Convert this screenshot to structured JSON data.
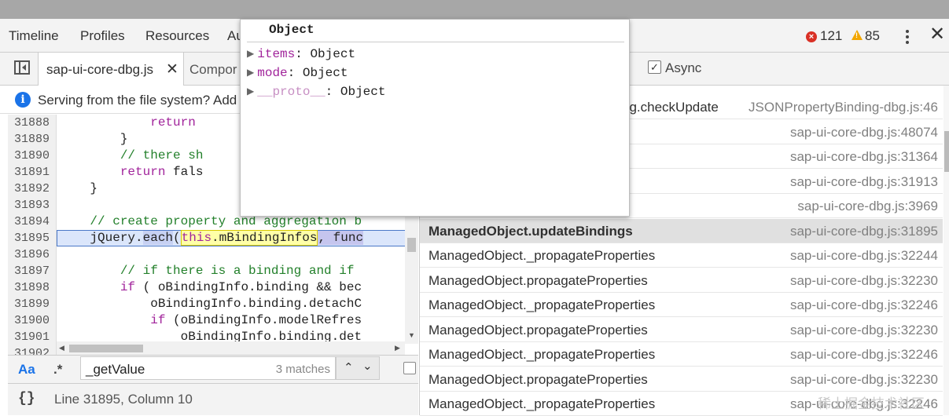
{
  "nav": {
    "tabs": [
      "Timeline",
      "Profiles",
      "Resources",
      "Au"
    ],
    "errors": "121",
    "warnings": "85"
  },
  "filetabs": {
    "active": "sap-ui-core-dbg.js",
    "second": "Compor"
  },
  "infobar": {
    "text": "Serving from the file system? Add"
  },
  "editor": {
    "line_numbers": [
      "31888",
      "31889",
      "31890",
      "31891",
      "31892",
      "31893",
      "31894",
      "31895",
      "31896",
      "31897",
      "31898",
      "31899",
      "31900",
      "31901",
      "31902"
    ]
  },
  "search": {
    "case_label": "Aa",
    "regex_label": ".*",
    "value": "_getValue",
    "matches": "3 matches"
  },
  "status": {
    "position": "Line 31895, Column 10"
  },
  "callstack": {
    "async_label": "Async",
    "frames": [
      {
        "fn": "ng.checkUpdate",
        "loc": "JSONPropertyBinding-dbg.js:46"
      },
      {
        "fn": "",
        "loc": "sap-ui-core-dbg.js:48074"
      },
      {
        "fn": "",
        "loc": "sap-ui-core-dbg.js:31364"
      },
      {
        "fn": "",
        "loc": "sap-ui-core-dbg.js:31913"
      },
      {
        "fn": "",
        "loc": "sap-ui-core-dbg.js:3969"
      },
      {
        "fn": "ManagedObject.updateBindings",
        "loc": "sap-ui-core-dbg.js:31895"
      },
      {
        "fn": "ManagedObject._propagateProperties",
        "loc": "sap-ui-core-dbg.js:32244"
      },
      {
        "fn": "ManagedObject.propagateProperties",
        "loc": "sap-ui-core-dbg.js:32230"
      },
      {
        "fn": "ManagedObject._propagateProperties",
        "loc": "sap-ui-core-dbg.js:32246"
      },
      {
        "fn": "ManagedObject.propagateProperties",
        "loc": "sap-ui-core-dbg.js:32230"
      },
      {
        "fn": "ManagedObject._propagateProperties",
        "loc": "sap-ui-core-dbg.js:32246"
      },
      {
        "fn": "ManagedObject.propagateProperties",
        "loc": "sap-ui-core-dbg.js:32230"
      },
      {
        "fn": "ManagedObject._propagateProperties",
        "loc": "sap-ui-core-dbg.js:32246"
      }
    ]
  },
  "popover": {
    "title": "Object",
    "props": [
      {
        "key": "items",
        "value": "Object"
      },
      {
        "key": "mode",
        "value": "Object"
      },
      {
        "key": "__proto__",
        "value": "Object"
      }
    ]
  },
  "watermark": "稀土掘金技术社区"
}
